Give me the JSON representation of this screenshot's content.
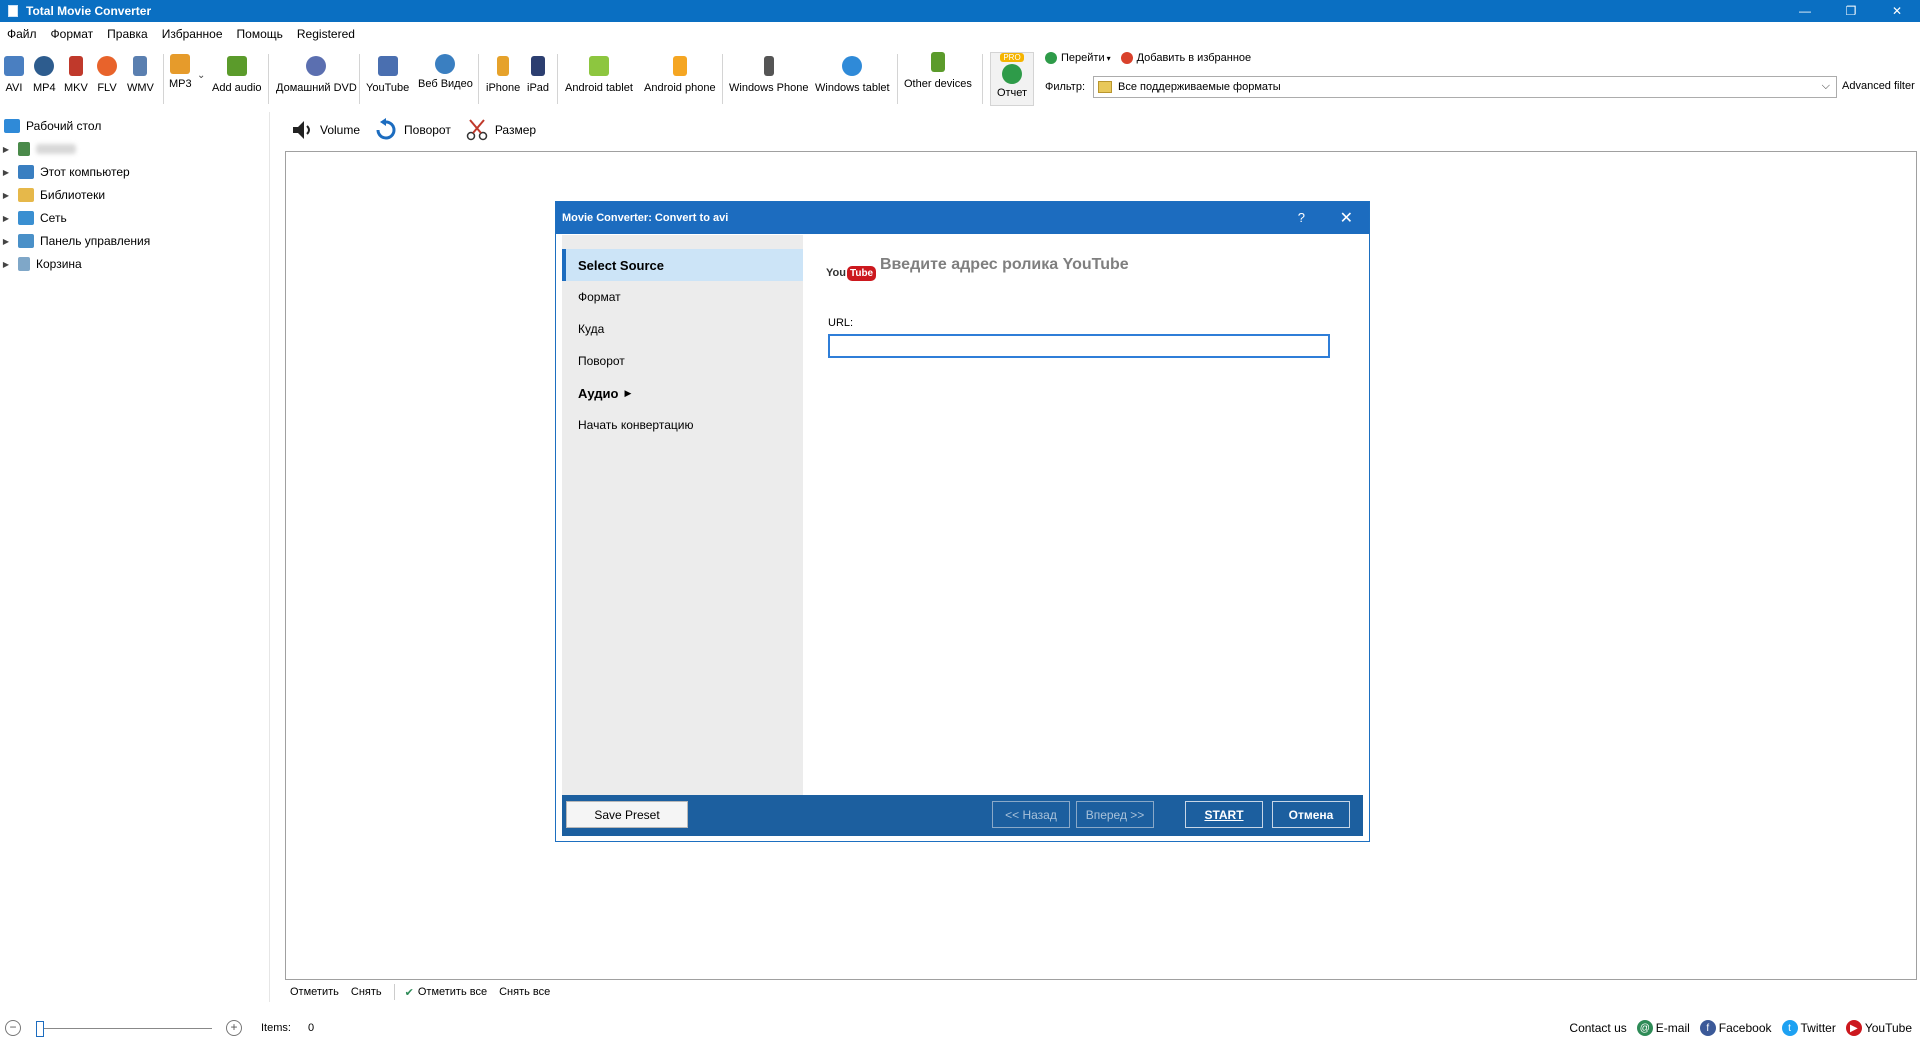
{
  "window": {
    "title": "Total Movie Converter",
    "minimize": "—",
    "restore": "❐",
    "close": "✕"
  },
  "menu": [
    "Файл",
    "Формат",
    "Правка",
    "Избранное",
    "Помощь",
    "Registered"
  ],
  "toolbar": {
    "items": [
      {
        "label": "AVI",
        "icon": "avi-icon",
        "color": "#4a7fc1"
      },
      {
        "label": "MP4",
        "icon": "mp4-eye-icon",
        "color": "#2d5c8e"
      },
      {
        "label": "MKV",
        "icon": "mkv-icon",
        "color": "#c0392b"
      },
      {
        "label": "FLV",
        "icon": "flv-icon",
        "color": "#e8632b"
      },
      {
        "label": "WMV",
        "icon": "wmv-icon",
        "color": "#5a7fb0"
      },
      {
        "label": "MP3",
        "icon": "mp3-icon",
        "color": "#e69b2b"
      },
      {
        "label": "Add audio",
        "icon": "add-audio-icon",
        "color": "#5b9b2b"
      },
      {
        "label": "Домашний DVD",
        "icon": "dvd-icon",
        "color": "#5b6fb0"
      },
      {
        "label": "YouTube",
        "icon": "youtube-icon",
        "color": "#4a6fb0"
      },
      {
        "label": "Веб Видео",
        "icon": "web-video-icon",
        "color": "#3a7fc1"
      },
      {
        "label": "iPhone",
        "icon": "iphone-icon",
        "color": "#e6a22b"
      },
      {
        "label": "iPad",
        "icon": "ipad-icon",
        "color": "#2c3e70"
      },
      {
        "label": "Android tablet",
        "icon": "android-icon",
        "color": "#8dc63f"
      },
      {
        "label": "Android phone",
        "icon": "android-phone-icon",
        "color": "#f5a623"
      },
      {
        "label": "Windows Phone",
        "icon": "windows-phone-icon",
        "color": "#555555"
      },
      {
        "label": "Windows tablet",
        "icon": "windows-tablet-icon",
        "color": "#2f8ad8"
      },
      {
        "label": "Other devices",
        "icon": "other-devices-icon",
        "color": "#5b9b2b"
      }
    ],
    "report": {
      "badge": "PRO",
      "label": "Отчет"
    },
    "go_label": "Перейти",
    "favorites_label": "Добавить в избранное",
    "filter_label": "Фильтр:",
    "filter_value": "Все поддерживаемые форматы",
    "advanced_filter": "Advanced filter"
  },
  "tree": {
    "root": "Рабочий стол",
    "items": [
      {
        "label": "",
        "icon": "user-icon",
        "color": "#4a8a4a"
      },
      {
        "label": "Этот компьютер",
        "icon": "computer-icon",
        "color": "#3a7fc1"
      },
      {
        "label": "Библиотеки",
        "icon": "libraries-icon",
        "color": "#e6b84a"
      },
      {
        "label": "Сеть",
        "icon": "network-icon",
        "color": "#3a8fd1"
      },
      {
        "label": "Панель управления",
        "icon": "control-panel-icon",
        "color": "#4a90c8"
      },
      {
        "label": "Корзина",
        "icon": "recycle-bin-icon",
        "color": "#7fa7c8"
      }
    ]
  },
  "effects": [
    {
      "label": "Volume",
      "icon": "volume-icon"
    },
    {
      "label": "Поворот",
      "icon": "rotate-icon"
    },
    {
      "label": "Размер",
      "icon": "scissors-icon"
    }
  ],
  "dialog": {
    "title": "Movie Converter:  Convert to avi",
    "help": "?",
    "close": "✕",
    "nav": [
      {
        "label": "Select Source",
        "active": true
      },
      {
        "label": "Формат"
      },
      {
        "label": "Куда"
      },
      {
        "label": "Поворот"
      },
      {
        "label": "Аудио",
        "bold": true
      },
      {
        "label": "Начать конвертацию"
      }
    ],
    "logo_you": "You",
    "logo_tube": "Tube",
    "heading": "Введите адрес ролика YouTube",
    "url_label": "URL:",
    "url_value": "",
    "buttons": {
      "save_preset": "Save Preset",
      "back": "<< Назад",
      "next": "Вперед >>",
      "start": "START",
      "cancel": "Отмена"
    }
  },
  "check_bar": [
    "Отметить",
    "Снять",
    "Отметить все",
    "Снять все"
  ],
  "status": {
    "items_label": "Items:",
    "items_value": "0",
    "contact": "Contact us",
    "social": [
      {
        "label": "E-mail",
        "icon": "email-icon",
        "color": "#2e8b57"
      },
      {
        "label": "Facebook",
        "icon": "facebook-icon",
        "color": "#3b5998"
      },
      {
        "label": "Twitter",
        "icon": "twitter-icon",
        "color": "#1da1f2"
      },
      {
        "label": "YouTube",
        "icon": "youtube-social-icon",
        "color": "#cc181e"
      }
    ]
  }
}
